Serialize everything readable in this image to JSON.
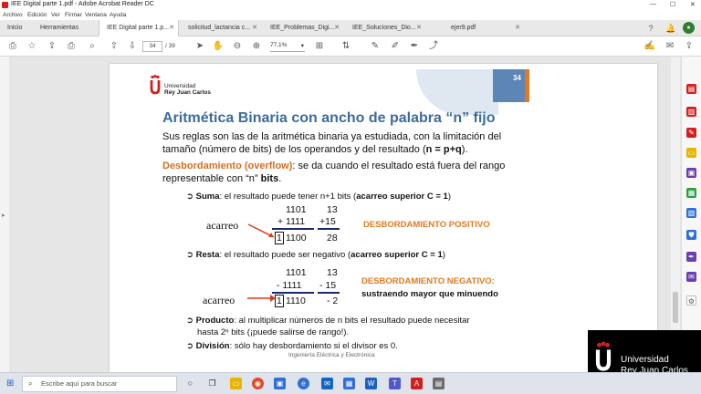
{
  "window": {
    "title": "IEE Digital parte 1.pdf - Adobe Acrobat Reader DC"
  },
  "menu": [
    "Archivo",
    "Edición",
    "Ver",
    "Firmar",
    "Ventana",
    "Ayuda"
  ],
  "tabs": {
    "home": "Inicio",
    "tools": "Herramientas",
    "docs": [
      "IEE Digital parte 1.p...",
      "solicitud_lactancia c...",
      "IEE_Problemas_Digi...",
      "IEE_Soluciones_Dio...",
      "ejer9.pdf"
    ]
  },
  "toolbar": {
    "page_current": "34",
    "page_total": "/ 39",
    "zoom": "77,1%"
  },
  "slide": {
    "number": "34",
    "university": [
      "Universidad",
      "Rey Juan Carlos"
    ],
    "title": "Aritmética Binaria con ancho de palabra “n” fijo",
    "para1_line1": "Sus reglas son las de la aritmética binaria ya estudiada, con la limitación del",
    "para1_line2_a": "tamaño (número de bits) de los operandos y del resultado (",
    "para1_line2_b": "n = p+q",
    "para1_line2_c": ").",
    "overflow_label": "Desbordamiento (overflow)",
    "overflow_rest": ": se da cuando el resultado está fuera del rango",
    "overflow_line2_a": "representable con “n” ",
    "overflow_line2_b": "bits",
    "overflow_line2_c": ".",
    "suma_label": "Suma",
    "suma_text": ": el resultado puede tener n+1 bits (",
    "suma_bold": "acarreo superior C = 1",
    "suma_end": ")",
    "suma_a": "1101",
    "suma_b": "+ 1111",
    "suma_r_carry": "1",
    "suma_r": "1100",
    "suma_dec_a": "13",
    "suma_dec_b": "+15",
    "suma_dec_r": "28",
    "acarreo": "acarreo",
    "pos_label": "DESBORDAMIENTO POSITIVO",
    "resta_label": "Resta",
    "resta_text": ": el resultado puede ser negativo (",
    "resta_bold": "acarreo superior C = 1",
    "resta_end": ")",
    "resta_a": "1101",
    "resta_b": "- 1111",
    "resta_r_carry": "1",
    "resta_r": "1110",
    "resta_dec_a": "13",
    "resta_dec_b": "- 15",
    "resta_dec_r": "- 2",
    "neg_label": "DESBORDAMIENTO NEGATIVO:",
    "neg_sub": "sustraendo mayor que minuendo",
    "prod_label": "Producto",
    "prod_text": ": al multiplicar números de n bits el resultado puede necesitar",
    "prod_line2": "hasta 2ⁿ bits (¡puede salirse de rango!).",
    "div_label": "División",
    "div_text": ": sólo hay desbordamiento si el divisor es 0.",
    "footer": "Ingeniería Eléctrica y Electrónica"
  },
  "watermark": {
    "line1": "Universidad",
    "line2": "Rey Juan Carlos"
  },
  "taskbar": {
    "search_placeholder": "Escribe aquí para buscar"
  },
  "colors": {
    "title": "#3c6c9a",
    "orange": "#e07a1e",
    "navy": "#1d2a66",
    "acrobat_red": "#d3201f"
  }
}
